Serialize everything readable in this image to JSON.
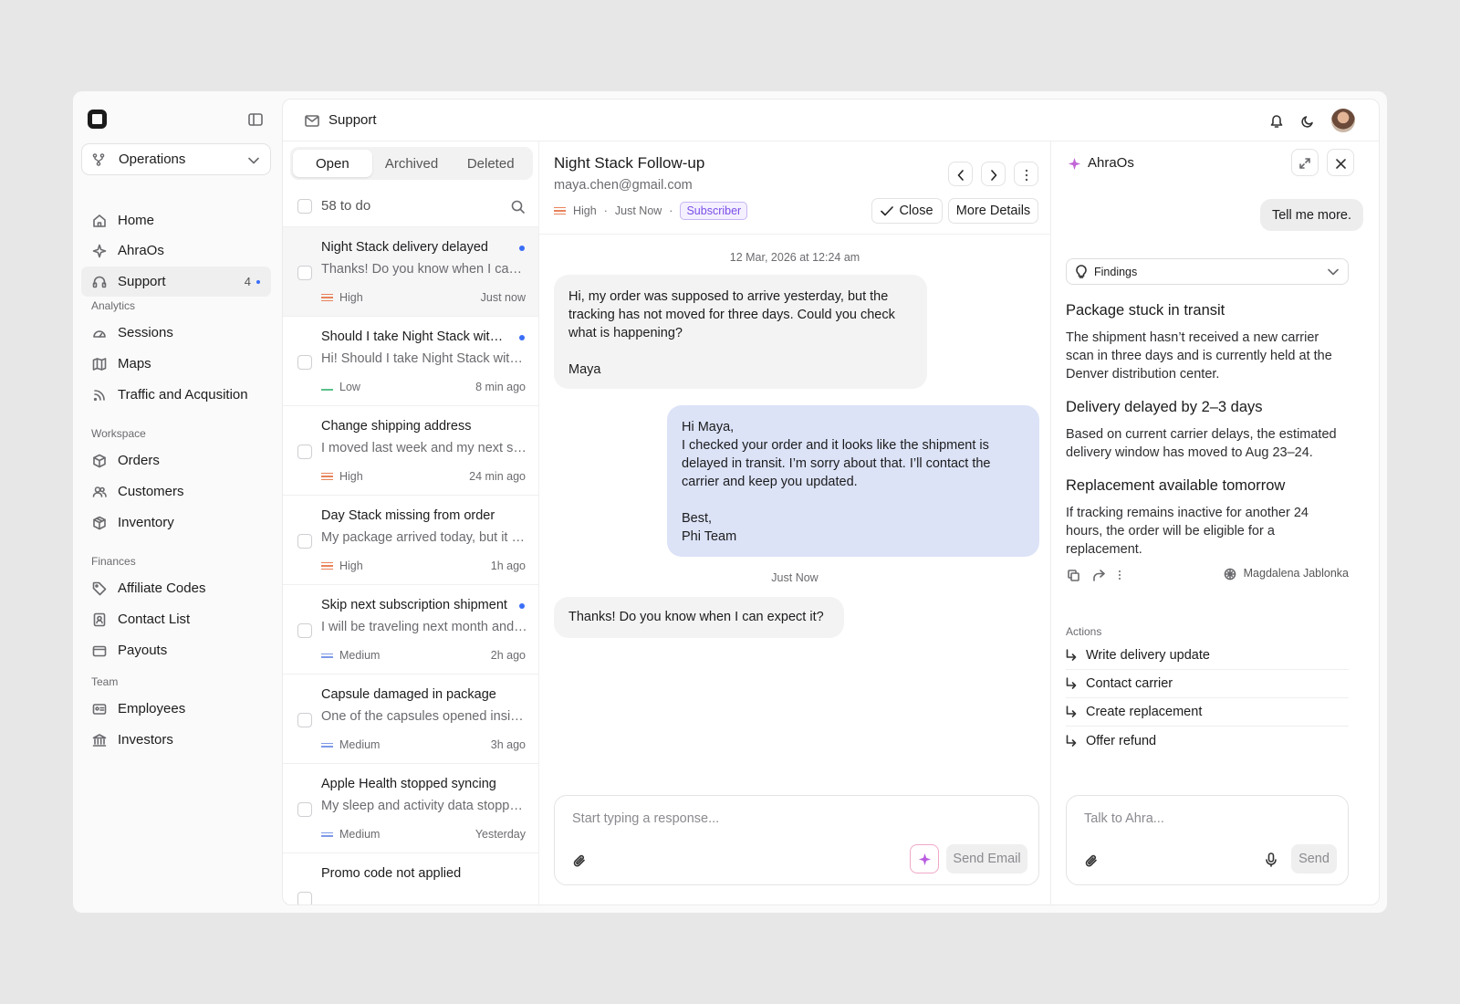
{
  "sidebar": {
    "workspace": "Operations",
    "nav_main": [
      {
        "label": "Home",
        "icon": "home-icon"
      },
      {
        "label": "AhraOs",
        "icon": "sparkle-icon"
      },
      {
        "label": "Support",
        "icon": "headset-icon",
        "count": "4"
      }
    ],
    "sections": [
      {
        "title": "Analytics",
        "items": [
          {
            "label": "Sessions",
            "icon": "gauge-icon"
          },
          {
            "label": "Maps",
            "icon": "map-icon"
          },
          {
            "label": "Traffic and Acqusition",
            "icon": "rss-icon"
          }
        ]
      },
      {
        "title": "Workspace",
        "items": [
          {
            "label": "Orders",
            "icon": "box-icon"
          },
          {
            "label": "Customers",
            "icon": "users-icon"
          },
          {
            "label": "Inventory",
            "icon": "package-icon"
          }
        ]
      },
      {
        "title": "Finances",
        "items": [
          {
            "label": "Affiliate Codes",
            "icon": "tag-icon"
          },
          {
            "label": "Contact List",
            "icon": "contact-icon"
          },
          {
            "label": "Payouts",
            "icon": "wallet-icon"
          }
        ]
      },
      {
        "title": "Team",
        "items": [
          {
            "label": "Employees",
            "icon": "id-card-icon"
          },
          {
            "label": "Investors",
            "icon": "bank-icon"
          }
        ]
      }
    ]
  },
  "topbar": {
    "title": "Support"
  },
  "inbox": {
    "tabs": [
      "Open",
      "Archived",
      "Deleted"
    ],
    "todo": "58 to do",
    "threads": [
      {
        "title": "Night Stack delivery delayed",
        "preview": "Thanks! Do you know when I can expect it?",
        "priority": "High",
        "time": "Just now",
        "unread": true
      },
      {
        "title": "Should I take Night Stack with food?",
        "preview": "Hi! Should I take Night Stack with dinner?",
        "priority": "Low",
        "time": "8 min ago",
        "unread": true
      },
      {
        "title": "Change shipping address",
        "preview": "I moved last week and my next shipment...",
        "priority": "High",
        "time": "24 min ago",
        "unread": false
      },
      {
        "title": "Day Stack missing from order",
        "preview": "My package arrived today, but it is missing",
        "priority": "High",
        "time": "1h ago",
        "unread": false
      },
      {
        "title": "Skip next subscription shipment",
        "preview": "I will be traveling next month and would like",
        "priority": "Medium",
        "time": "2h ago",
        "unread": true
      },
      {
        "title": "Capsule damaged in package",
        "preview": "One of the capsules opened inside the box",
        "priority": "Medium",
        "time": "3h ago",
        "unread": false
      },
      {
        "title": "Apple Health stopped syncing",
        "preview": "My sleep and activity data stopped syncing",
        "priority": "Medium",
        "time": "Yesterday",
        "unread": false
      },
      {
        "title": "Promo code not applied",
        "preview": "",
        "priority": "",
        "time": "",
        "unread": false
      }
    ]
  },
  "conversation": {
    "subject": "Night Stack Follow-up",
    "email": "maya.chen@gmail.com",
    "priority": "High",
    "time": "Just Now",
    "badge": "Subscriber",
    "close_label": "Close",
    "details_label": "More Details",
    "date": "12 Mar, 2026 at 12:24 am",
    "msg1": "Hi, my order was supposed to arrive yesterday, but the tracking has not moved for three days. Could you check what is happening?\n\nMaya",
    "msg2": "Hi Maya,\nI checked your order and it looks like the shipment is delayed in transit. I’m sorry about that. I’ll contact the carrier and keep you updated.\n\nBest,\nPhi Team",
    "time2": "Just Now",
    "msg3": "Thanks! Do you know when I can expect it?",
    "placeholder": "Start typing a response...",
    "send_label": "Send Email"
  },
  "assistant": {
    "name": "AhraOs",
    "query": "Tell me more.",
    "findings_label": "Findings",
    "findings": [
      {
        "title": "Package stuck in transit",
        "body": "The shipment hasn’t received a new carrier scan in three days and is currently held at the Denver distribution center."
      },
      {
        "title": "Delivery delayed by 2–3 days",
        "body": "Based on current carrier delays, the estimated delivery window has moved to Aug 23–24."
      },
      {
        "title": "Replacement available tomorrow",
        "body": "If tracking remains inactive for another 24 hours, the order will be eligible for a replacement."
      }
    ],
    "author": "Magdalena Jablonka",
    "actions_label": "Actions",
    "actions": [
      "Write delivery update",
      "Contact carrier",
      "Create replacement",
      "Offer refund"
    ],
    "placeholder": "Talk to Ahra...",
    "send_label": "Send"
  },
  "colors": {
    "high": "#e8825a",
    "low": "#5cc08a",
    "medium": "#7e9ae8",
    "accent": "#3b6ef6",
    "outgoing_bubble": "#dce3f7",
    "ai_sparkle": "#c266d6"
  }
}
